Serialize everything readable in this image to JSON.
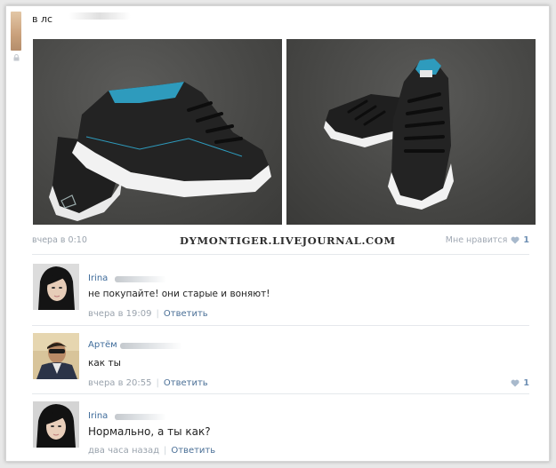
{
  "post": {
    "text": "в лс",
    "time": "вчера в 0:10",
    "watermark": "DYMONTIGER.LIVEJOURNAL.COM",
    "like_label": "Мне нравится",
    "like_count": "1"
  },
  "comments": [
    {
      "author": "Irina",
      "text": "не покупайте! они старые и воняют!",
      "time": "вчера в 19:09",
      "reply": "Ответить"
    },
    {
      "author": "Артём",
      "text": "как ты",
      "time": "вчера в 20:55",
      "reply": "Ответить",
      "likes": "1"
    },
    {
      "author": "Irina",
      "text": "Нормально, а ты как?",
      "time": "два часа назад",
      "reply": "Ответить"
    }
  ],
  "colors": {
    "link": "#3e6b9a",
    "meta": "#9aa3ad",
    "like": "#6d8fb3"
  }
}
